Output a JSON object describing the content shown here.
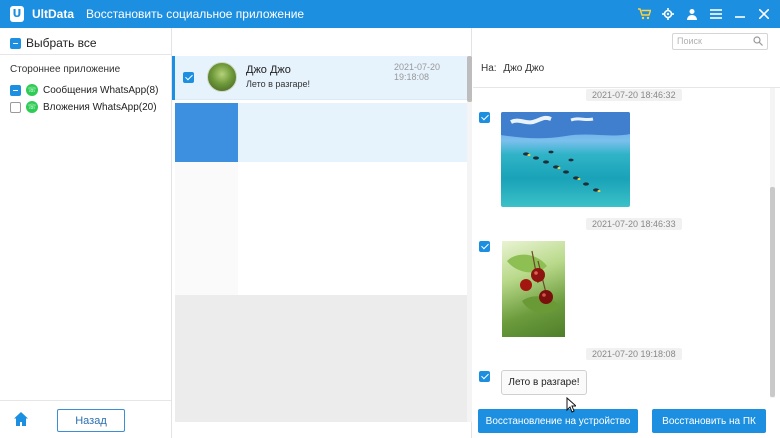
{
  "app": {
    "logo_letter": "U",
    "name": "UltData",
    "subtitle": "Восстановить социальное приложение"
  },
  "titlebar_icons": [
    "cart-icon",
    "settings-icon",
    "user-icon",
    "menu-icon",
    "minimize-icon",
    "close-icon"
  ],
  "colors": {
    "accent": "#1d8fe1",
    "whatsapp": "#2ecc55",
    "cart": "#ffd23f"
  },
  "left": {
    "select_all_label": "Выбрать все",
    "section_label": "Стороннее приложение",
    "items": [
      {
        "label": "Сообщения WhatsApp(8)",
        "state": "partial"
      },
      {
        "label": "Вложения WhatsApp(20)",
        "state": "unchecked"
      }
    ],
    "back_label": "Назад"
  },
  "search": {
    "placeholder": "Поиск"
  },
  "chat": {
    "name": "Джо Джо",
    "preview": "Лето в разгаре!",
    "time": "2021-07-20 19:18:08"
  },
  "right": {
    "to_prefix": "На:",
    "to_name": "Джо Джо",
    "messages": [
      {
        "time": "2021-07-20 18:46:32",
        "type": "image"
      },
      {
        "time": "2021-07-20 18:46:33",
        "type": "image"
      },
      {
        "time": "2021-07-20 19:18:08",
        "type": "text",
        "text": "Лето в разгаре!"
      }
    ],
    "restore_device_label": "Восстановление на устройство",
    "restore_pc_label": "Восстановить на ПК"
  }
}
